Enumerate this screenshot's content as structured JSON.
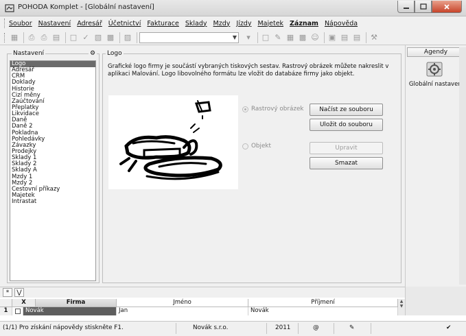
{
  "window": {
    "title": "POHODA Komplet - [Globální nastavení]"
  },
  "menu": [
    {
      "label": "Soubor"
    },
    {
      "label": "Nastavení"
    },
    {
      "label": "Adresář"
    },
    {
      "label": "Účetnictví"
    },
    {
      "label": "Fakturace"
    },
    {
      "label": "Sklady"
    },
    {
      "label": "Mzdy"
    },
    {
      "label": "Jízdy"
    },
    {
      "label": "Majetek"
    },
    {
      "label": "Záznam"
    },
    {
      "label": "Nápověda"
    }
  ],
  "nav": {
    "legend": "Nastavení",
    "items": [
      "Logo",
      "Adresář",
      "CRM",
      "Doklady",
      "Historie",
      "Cizí měny",
      "Zaúčtování",
      "Přeplatky",
      "Likvidace",
      "Daně",
      "Daně 2",
      "Pokladna",
      "Pohledávky",
      "Závazky",
      "Prodejky",
      "Sklady 1",
      "Sklady 2",
      "Sklady A",
      "Mzdy 1",
      "Mzdy 2",
      "Cestovní příkazy",
      "Majetek",
      "Intrastat"
    ],
    "selected": "Logo"
  },
  "logo": {
    "legend": "Logo",
    "description": "Grafické logo firmy je součástí vybraných tiskových sestav. Rastrový obrázek můžete nakreslit v aplikaci Malování. Logo libovolného formátu lze vložit do databáze firmy jako objekt.",
    "radio_raster": "Rastrový obrázek",
    "radio_object": "Objekt",
    "btn_load": "Načíst ze souboru",
    "btn_save": "Uložit do souboru",
    "btn_edit": "Upravit",
    "btn_delete": "Smazat"
  },
  "agendy": {
    "header": "Agendy",
    "item_label": "Globální nastavení"
  },
  "grid": {
    "columns": {
      "sel": "X",
      "firma": "Firma",
      "jmeno": "Jméno",
      "prijmeni": "Příjmení"
    },
    "rows": [
      {
        "num": "1",
        "firma": "Novák",
        "jmeno": "Jan",
        "prijmeni": "Novák"
      }
    ]
  },
  "status": {
    "record": "(1/1) Pro získání nápovědy stiskněte F1.",
    "company": "Novák s.r.o.",
    "year": "2011"
  },
  "colors": {
    "selection": "#6b6b6b",
    "close_button": "#c8442a"
  }
}
